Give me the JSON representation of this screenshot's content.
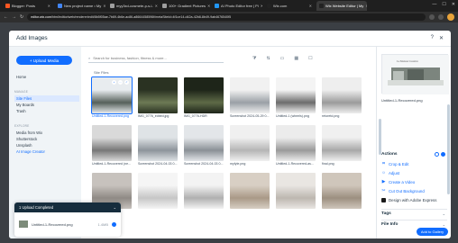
{
  "browser": {
    "tabs": [
      {
        "label": "Blogger: Posts",
        "color": "#ff5722",
        "active": false
      },
      {
        "label": "New project name • My",
        "color": "#4285f4",
        "active": false
      },
      {
        "label": "myy3xd-cosmete-p-s-i-",
        "color": "#9e9e9e",
        "active": false
      },
      {
        "label": "100+ Gradient Pictures",
        "color": "#9e9e9e",
        "active": false
      },
      {
        "label": "AI Photo Editor free | Pi",
        "color": "#2196f3",
        "active": false
      },
      {
        "label": "Wix.com",
        "color": "#222222",
        "active": false
      },
      {
        "label": "Wix Website Editor | My",
        "color": "#222222",
        "active": true
      }
    ],
    "url_host": "editor.wix.com",
    "url_rest": "/html/editor/web/renderer/edit/8b5f05ae-7b69-4b6e-ac86-a8664458596f/metaSiteId=4f1ce14-d42a-42b8-8b49-9ab4676540f5"
  },
  "modal": {
    "title": "Add Images",
    "upload_button": "+ Upload Media",
    "nav": {
      "home": "Home",
      "manage_label": "MANAGE",
      "manage": [
        "Site Files",
        "My Boards",
        "Trash"
      ],
      "explore_label": "EXPLORE",
      "explore": [
        "Media from Wix",
        "Shutterstock",
        "Unsplash",
        "AI Image Creator"
      ]
    },
    "search": {
      "placeholder": "Search for business, fashion, fitness & more..."
    },
    "breadcrumb": "Site Files",
    "files": [
      {
        "name": "Untitled-1-Recovered.png",
        "colors": [
          "#e8ecef",
          "#56605a"
        ],
        "selected": true
      },
      {
        "name": "IMG_0776_edited.jpg",
        "colors": [
          "#2a3222",
          "#6d7a55"
        ],
        "selected": false
      },
      {
        "name": "IMG_0776-HDR",
        "colors": [
          "#1e2519",
          "#5e6a47"
        ],
        "selected": false
      },
      {
        "name": "Screenshot 2024-05-29 0...",
        "colors": [
          "#f1f1f1",
          "#9aa0a6"
        ],
        "selected": false
      },
      {
        "name": "Untitled-1 (wheels).png",
        "colors": [
          "#f4f4f4",
          "#6c6c6c"
        ],
        "selected": false
      },
      {
        "name": "retoretd.png",
        "colors": [
          "#eeeeee",
          "#9b9b9b"
        ],
        "selected": false
      },
      {
        "name": "Untitled-1-Recovered (ne...",
        "colors": [
          "#d9d9d9",
          "#777777"
        ],
        "selected": false
      },
      {
        "name": "Screenshot 2024-04-03 0...",
        "colors": [
          "#dfe3e6",
          "#8d949b"
        ],
        "selected": false
      },
      {
        "name": "Screenshot 2024-04-03 0...",
        "colors": [
          "#e3e6e9",
          "#8a9096"
        ],
        "selected": false
      },
      {
        "name": "myfyle.png",
        "colors": [
          "#f0f0f0",
          "#b5b5b5"
        ],
        "selected": false
      },
      {
        "name": "Untitled-1-Recovered-as...",
        "colors": [
          "#ececec",
          "#9a9a9a"
        ],
        "selected": false
      },
      {
        "name": "final.png",
        "colors": [
          "#f0f0f0",
          "#a8a8a8"
        ],
        "selected": false
      },
      {
        "name": "",
        "colors": [
          "#c7c2bd",
          "#8f8a85"
        ],
        "selected": false
      },
      {
        "name": "",
        "colors": [
          "#f5f5f5",
          "#c6c6c6"
        ],
        "selected": false
      },
      {
        "name": "",
        "colors": [
          "#f3f3f3",
          "#b0b0b0"
        ],
        "selected": false
      },
      {
        "name": "",
        "colors": [
          "#d8cfc4",
          "#a99987"
        ],
        "selected": false
      },
      {
        "name": "",
        "colors": [
          "#e9e6e2",
          "#bdb7b0"
        ],
        "selected": false
      },
      {
        "name": "",
        "colors": [
          "#cfc6bb",
          "#9c8f80"
        ],
        "selected": false
      }
    ],
    "upload_panel": {
      "title": "1 Upload Completed",
      "file_name": "Untitled-1-Recovered.png",
      "file_size": "1.4MB"
    },
    "details": {
      "file_name": "Untitled-1-Recovered.png",
      "actions_title": "Actions",
      "actions": [
        "Crop & Edit",
        "Adjust",
        "Create a Video",
        "Cut Out Background",
        "Design with Adobe Express"
      ],
      "tags_title": "Tags",
      "file_info_title": "File Info",
      "add_button": "Add to Gallery"
    }
  },
  "colors": {
    "accent": "#116dff",
    "sidebar": "#f0f4f7",
    "header_dark": "#162d3d"
  }
}
